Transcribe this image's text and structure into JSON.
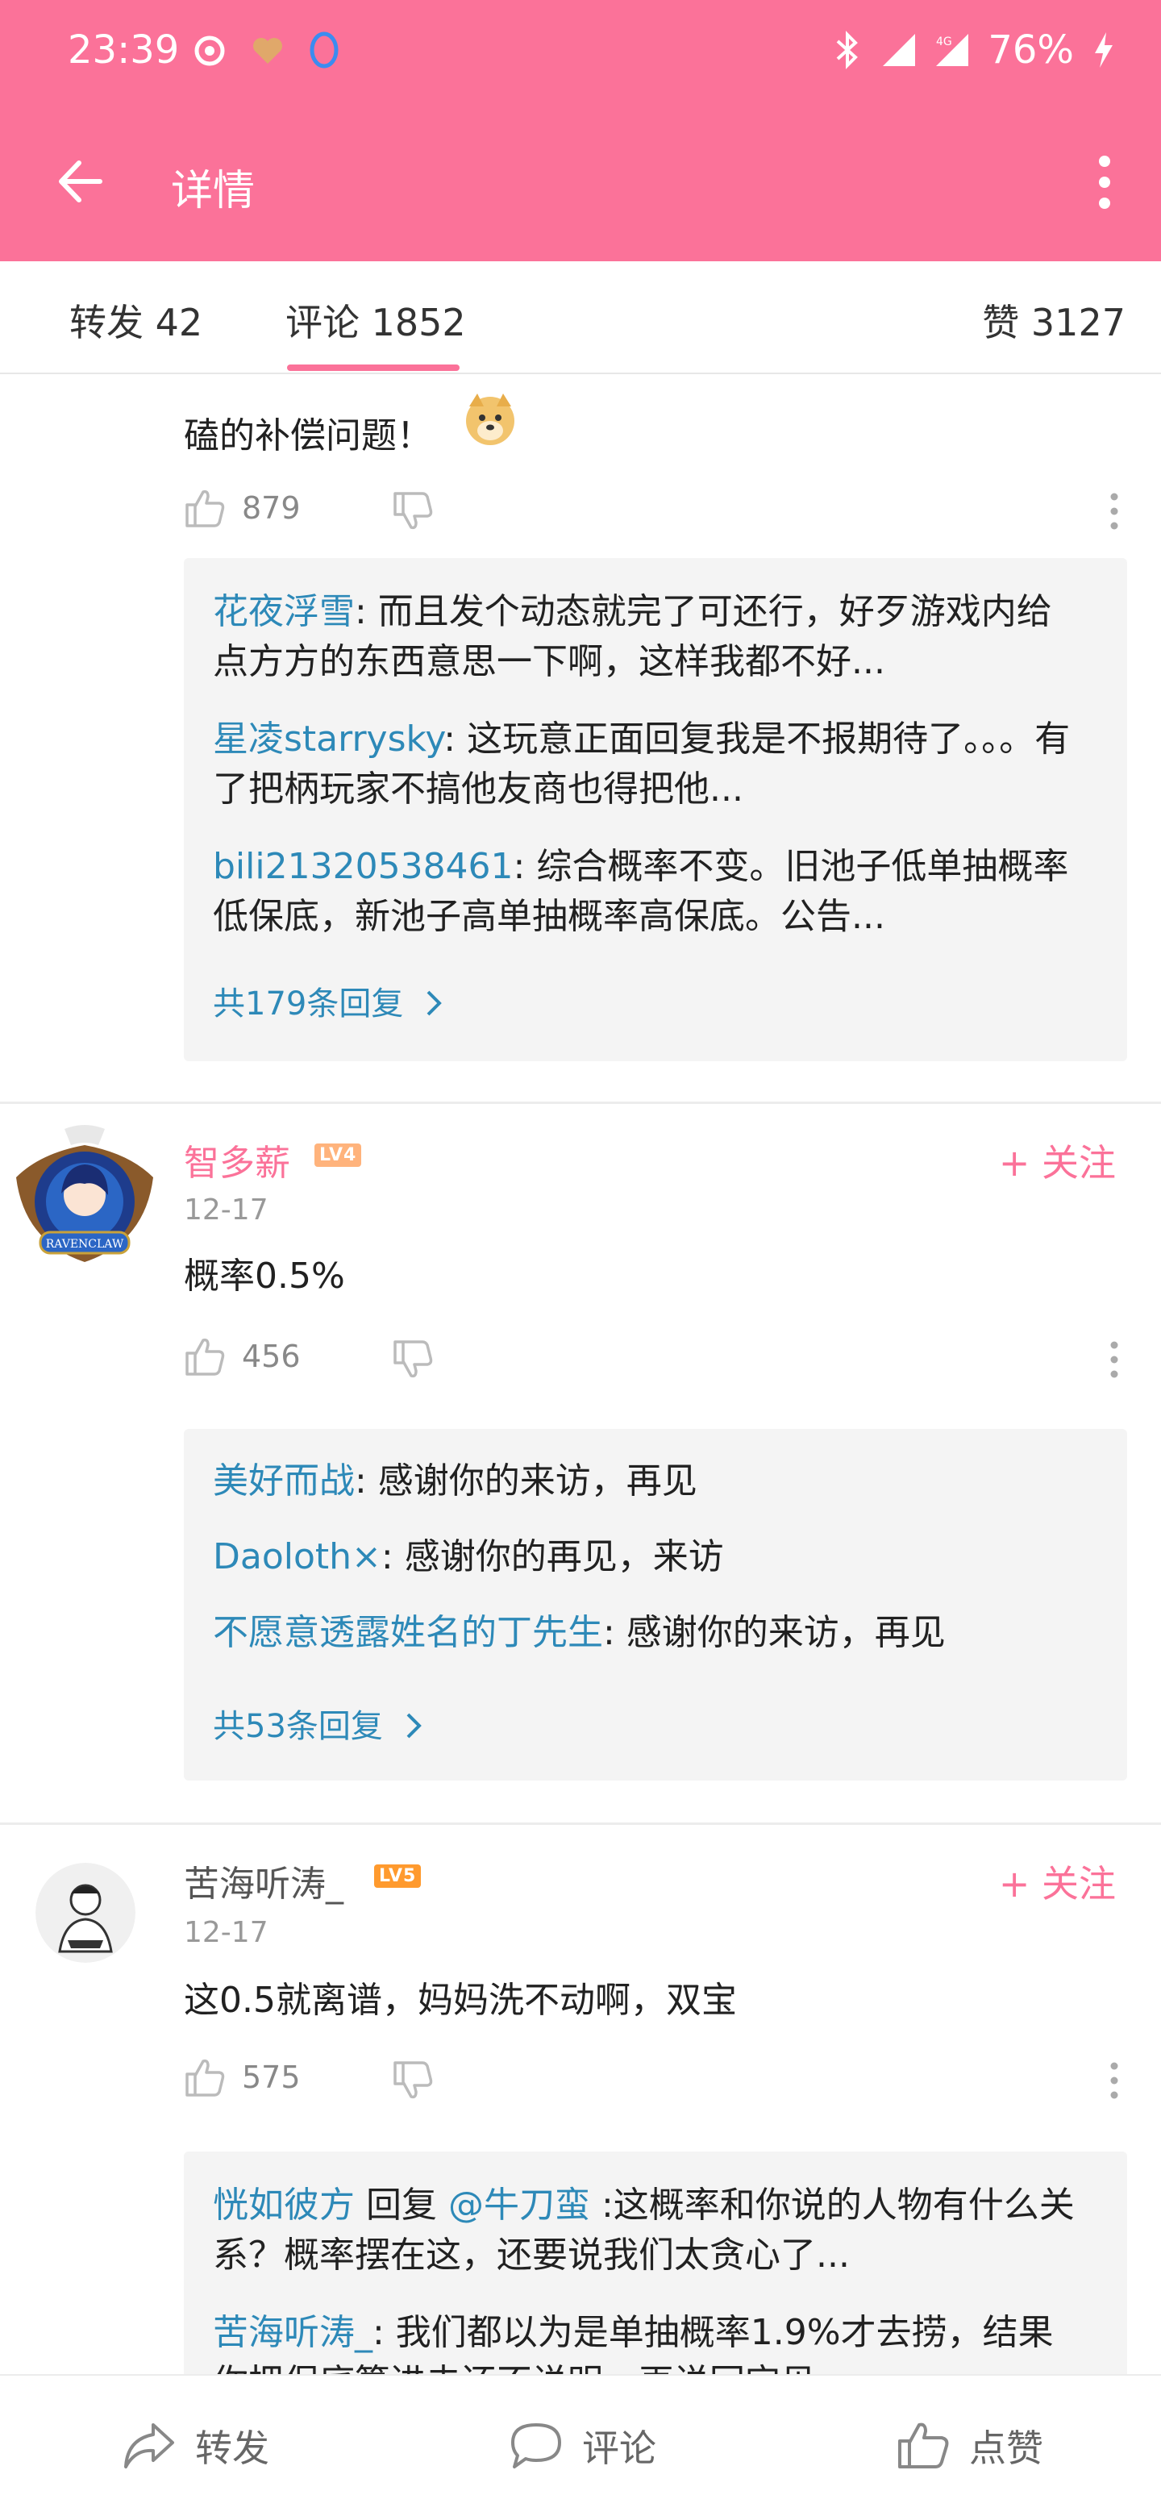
{
  "status": {
    "time": "23:39",
    "battery": "76%"
  },
  "appbar": {
    "title": "详情"
  },
  "tabs": {
    "repost": "转发 42",
    "comments": "评论 1852",
    "likes": "赞 3127"
  },
  "comments": [
    {
      "text": "磕的补偿问题！",
      "likes": "879",
      "replies": [
        {
          "user": "花夜浮雪",
          "text": ": 而且发个动态就完了可还行，好歹游戏内给点方方的东西意思一下啊，这样我都不好..."
        },
        {
          "user": "星凌starrysky",
          "text": ": 这玩意正面回复我是不报期待了。。。有了把柄玩家不搞他友商也得把他..."
        },
        {
          "user": "bili21320538461",
          "text": ": 综合概率不变。旧池子低单抽概率低保底，新池子高单抽概率高保底。公告..."
        }
      ],
      "more_replies": "共179条回复"
    },
    {
      "user": "智多薪",
      "level": "LV4",
      "follow": "+ 关注",
      "date": "12-17",
      "text": "概率0.5%",
      "likes": "456",
      "replies": [
        {
          "user": "美好而战",
          "text": ": 感谢你的来访，再见"
        },
        {
          "user": "Daoloth×",
          "text": ": 感谢你的再见，来访"
        },
        {
          "user": "不愿意透露姓名的丁先生",
          "text": ": 感谢你的来访，再见"
        }
      ],
      "more_replies": "共53条回复"
    },
    {
      "user": "苦海听涛_",
      "level": "LV5",
      "follow": "+ 关注",
      "date": "12-17",
      "text": "这0.5就离谱，妈妈洗不动啊，双宝",
      "likes": "575",
      "replies": [
        {
          "user": "恍如彼方",
          "mid": " 回复 ",
          "mention": "@牛刀蛮",
          "text": " :这概率和你说的人物有什么关系？概率摆在这，还要说我们太贪心了..."
        },
        {
          "user": "苦海听涛_",
          "text": ": 我们都以为是单抽概率1.9%才去捞，结果你把保底算进去还不说明，再说回宝贝"
        }
      ]
    }
  ],
  "bottombar": {
    "repost": "转发",
    "comment": "评论",
    "like": "点赞"
  },
  "colors": {
    "brand": "#fb7299",
    "link": "#2d89b8"
  }
}
